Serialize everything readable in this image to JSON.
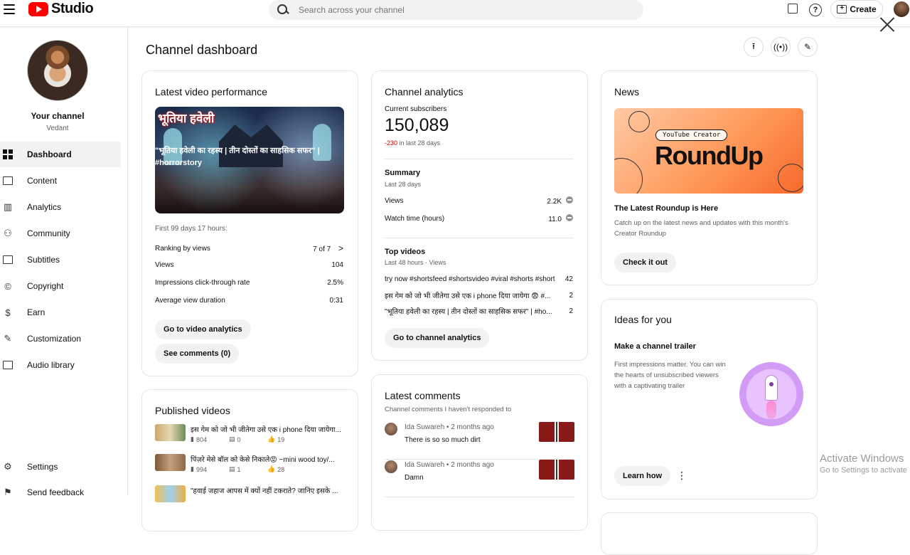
{
  "app": {
    "logo_text": "Studio"
  },
  "search": {
    "placeholder": "Search across your channel"
  },
  "topbar": {
    "create_label": "Create",
    "help_glyph": "?"
  },
  "sidebar": {
    "your_channel": "Your channel",
    "channel_name": "Vedant",
    "items": [
      {
        "label": "Dashboard",
        "icon": "dashboard-icon"
      },
      {
        "label": "Content",
        "icon": "content-icon"
      },
      {
        "label": "Analytics",
        "icon": "analytics-icon"
      },
      {
        "label": "Community",
        "icon": "community-icon"
      },
      {
        "label": "Subtitles",
        "icon": "subtitles-icon"
      },
      {
        "label": "Copyright",
        "icon": "copyright-icon"
      },
      {
        "label": "Earn",
        "icon": "earn-icon"
      },
      {
        "label": "Customization",
        "icon": "customization-icon"
      },
      {
        "label": "Audio library",
        "icon": "audio-library-icon"
      }
    ],
    "settings": "Settings",
    "feedback": "Send feedback"
  },
  "page": {
    "title": "Channel dashboard"
  },
  "latest_video": {
    "title": "Latest video performance",
    "thumb_title": "भूतिया हवेली",
    "caption": "\"भूतिया हवेली का रहस्य | तीन दोस्तों का साहसिक सफर\" | #horrorstory",
    "period": "First 99 days 17 hours:",
    "ranking_label": "Ranking by views",
    "ranking_value": "7 of 7",
    "chevron": ">",
    "stats": [
      {
        "label": "Views",
        "value": "104"
      },
      {
        "label": "Impressions click-through rate",
        "value": "2.5%"
      },
      {
        "label": "Average view duration",
        "value": "0:31"
      }
    ],
    "btn_analytics": "Go to video analytics",
    "btn_comments": "See comments (0)"
  },
  "published": {
    "title": "Published videos",
    "videos": [
      {
        "title": "इस गेम को जो भी जीतेगा उसे एक i phone दिया जायेगा...",
        "views": "804",
        "comments": "0",
        "likes": "19"
      },
      {
        "title": "पिंज़रे मेसे बॉल को केसे निकाले😡 ~mini wood toy/...",
        "views": "994",
        "comments": "1",
        "likes": "28"
      },
      {
        "title": "\"हवाई जहाज आपस में क्यों नहीं टकराते? जानिए इसके ...",
        "views": "",
        "comments": "",
        "likes": ""
      }
    ]
  },
  "analytics": {
    "title": "Channel analytics",
    "subs_label": "Current subscribers",
    "subs_value": "150,089",
    "subs_change": "-230",
    "subs_change_period": "in last 28 days",
    "summary_title": "Summary",
    "summary_period": "Last 28 days",
    "summary": [
      {
        "label": "Views",
        "value": "2.2K"
      },
      {
        "label": "Watch time (hours)",
        "value": "11.0"
      }
    ],
    "top_title": "Top videos",
    "top_period": "Last 48 hours · Views",
    "top_videos": [
      {
        "title": "try now #shortsfeed #shortsvideo #viral #shorts #short",
        "views": "42"
      },
      {
        "title": "इस गेम को जो भी जीतेगा उसे एक i phone दिया जायेगा 😨 #...",
        "views": "2"
      },
      {
        "title": "\"भूतिया हवेली का रहस्य | तीन दोस्तों का साहसिक सफर\" | #ho...",
        "views": "2"
      }
    ],
    "btn": "Go to channel analytics"
  },
  "comments": {
    "title": "Latest comments",
    "subtitle": "Channel comments I haven't responded to",
    "items": [
      {
        "author": "Ida Suwareh",
        "time": "2 months ago",
        "text": "There is so so much dirt"
      },
      {
        "author": "Ida Suwareh",
        "time": "2 months ago",
        "text": "Damn"
      }
    ]
  },
  "news": {
    "title": "News",
    "badge": "YouTube Creator",
    "big": "RoundUp",
    "headline": "The Latest Roundup is Here",
    "body": "Catch up on the latest news and updates with this month's Creator Roundup",
    "btn": "Check it out"
  },
  "ideas": {
    "title": "Ideas for you",
    "headline": "Make a channel trailer",
    "body": "First impressions matter. You can win the hearts of unsubscribed viewers with a captivating trailer",
    "btn": "Learn how",
    "more_glyph": "⋮"
  },
  "watermark": {
    "line1": "Activate Windows",
    "line2": "Go to Settings to activate"
  },
  "colors": {
    "accent_red": "#ff0000",
    "negative": "#cc0000"
  }
}
